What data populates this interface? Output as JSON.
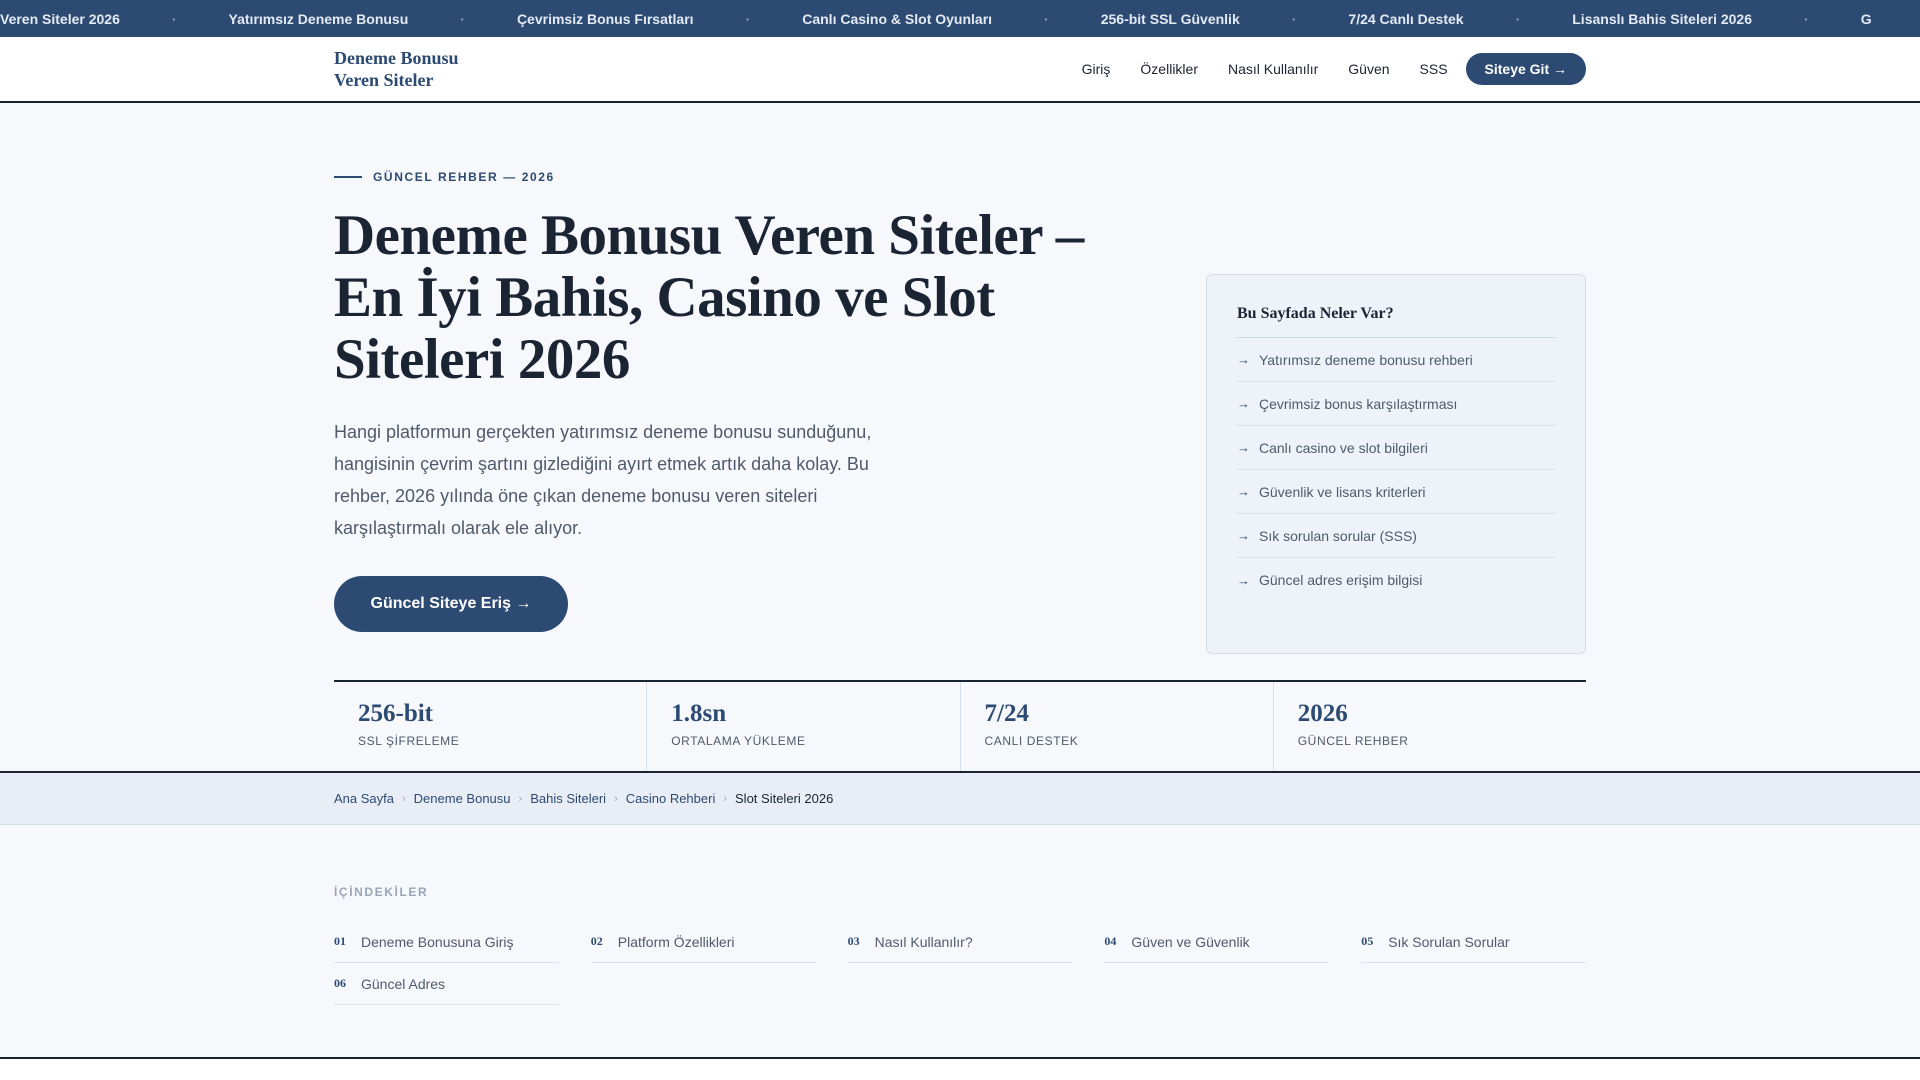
{
  "ticker": {
    "items": [
      "Veren Siteler 2026",
      "Yatırımsız Deneme Bonusu",
      "Çevrimsiz Bonus Fırsatları",
      "Canlı Casino & Slot Oyunları",
      "256-bit SSL Güvenlik",
      "7/24 Canlı Destek",
      "Lisanslı Bahis Siteleri 2026",
      "G"
    ],
    "separator": "·"
  },
  "nav": {
    "logo_line1": "Deneme Bonusu",
    "logo_line2": "Veren Siteler",
    "links": [
      "Giriş",
      "Özellikler",
      "Nasıl Kullanılır",
      "Güven",
      "SSS"
    ],
    "cta": "Siteye Git →"
  },
  "hero": {
    "eyebrow": "GÜNCEL REHBER — 2026",
    "title": "Deneme Bonusu Veren Siteler – En İyi Bahis, Casino ve Slot Siteleri 2026",
    "description": "Hangi platformun gerçekten yatırımsız deneme bonusu sunduğunu, hangisinin çevrim şartını gizlediğini ayırt etmek artık daha kolay. Bu rehber, 2026 yılında öne çıkan deneme bonusu veren siteleri karşılaştırmalı olarak ele alıyor.",
    "button": "Güncel Siteye Eriş →"
  },
  "toc_card": {
    "title": "Bu Sayfada Neler Var?",
    "items": [
      "Yatırımsız deneme bonusu rehberi",
      "Çevrimsiz bonus karşılaştırması",
      "Canlı casino ve slot bilgileri",
      "Güvenlik ve lisans kriterleri",
      "Sık sorulan sorular (SSS)",
      "Güncel adres erişim bilgisi"
    ]
  },
  "stats": [
    {
      "value": "256-bit",
      "label": "SSL ŞİFRELEME"
    },
    {
      "value": "1.8sn",
      "label": "ORTALAMA YÜKLEME"
    },
    {
      "value": "7/24",
      "label": "CANLI DESTEK"
    },
    {
      "value": "2026",
      "label": "GÜNCEL REHBER"
    }
  ],
  "breadcrumb": {
    "items": [
      "Ana Sayfa",
      "Deneme Bonusu",
      "Bahis Siteleri",
      "Casino Rehberi"
    ],
    "current": "Slot Siteleri 2026",
    "separator": "›"
  },
  "contents": {
    "title": "İÇİNDEKİLER",
    "items": [
      {
        "num": "01",
        "label": "Deneme Bonusuna Giriş"
      },
      {
        "num": "02",
        "label": "Platform Özellikleri"
      },
      {
        "num": "03",
        "label": "Nasıl Kullanılır?"
      },
      {
        "num": "04",
        "label": "Güven ve Güvenlik"
      },
      {
        "num": "05",
        "label": "Sık Sorulan Sorular"
      },
      {
        "num": "06",
        "label": "Güncel Adres"
      }
    ]
  },
  "colors": {
    "brand": "#2c4a72",
    "text": "#1b2433",
    "muted": "#4f5a6b",
    "background": "#f6f8fc"
  },
  "icons": {
    "toc_arrow": "arrow-right-icon",
    "breadcrumb_separator": "chevron-right-icon"
  }
}
